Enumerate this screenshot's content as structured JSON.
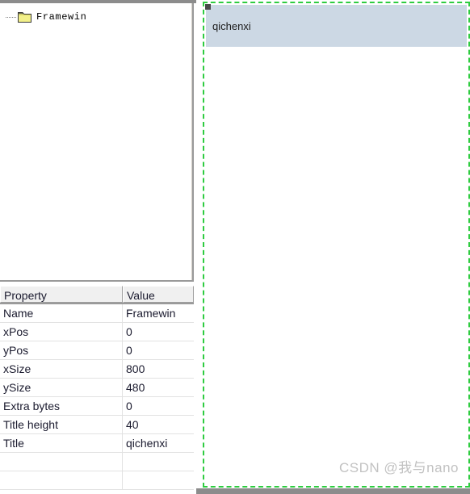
{
  "tree": {
    "items": [
      {
        "label": "Framewin",
        "icon": "folder-icon"
      }
    ]
  },
  "properties": {
    "headers": {
      "property": "Property",
      "value": "Value"
    },
    "rows": [
      {
        "property": "Name",
        "value": "Framewin"
      },
      {
        "property": "xPos",
        "value": "0"
      },
      {
        "property": "yPos",
        "value": "0"
      },
      {
        "property": "xSize",
        "value": "800"
      },
      {
        "property": "ySize",
        "value": "480"
      },
      {
        "property": "Extra bytes",
        "value": "0"
      },
      {
        "property": "Title height",
        "value": "40"
      },
      {
        "property": "Title",
        "value": "qichenxi"
      },
      {
        "property": "",
        "value": ""
      },
      {
        "property": "",
        "value": ""
      }
    ]
  },
  "canvas": {
    "framewin": {
      "title": "qichenxi",
      "selection_color": "#2ecc40",
      "titlebar_color": "#ccd8e4",
      "client_color": "#ffffff"
    }
  },
  "watermark": {
    "text": "CSDN @我与nano"
  }
}
